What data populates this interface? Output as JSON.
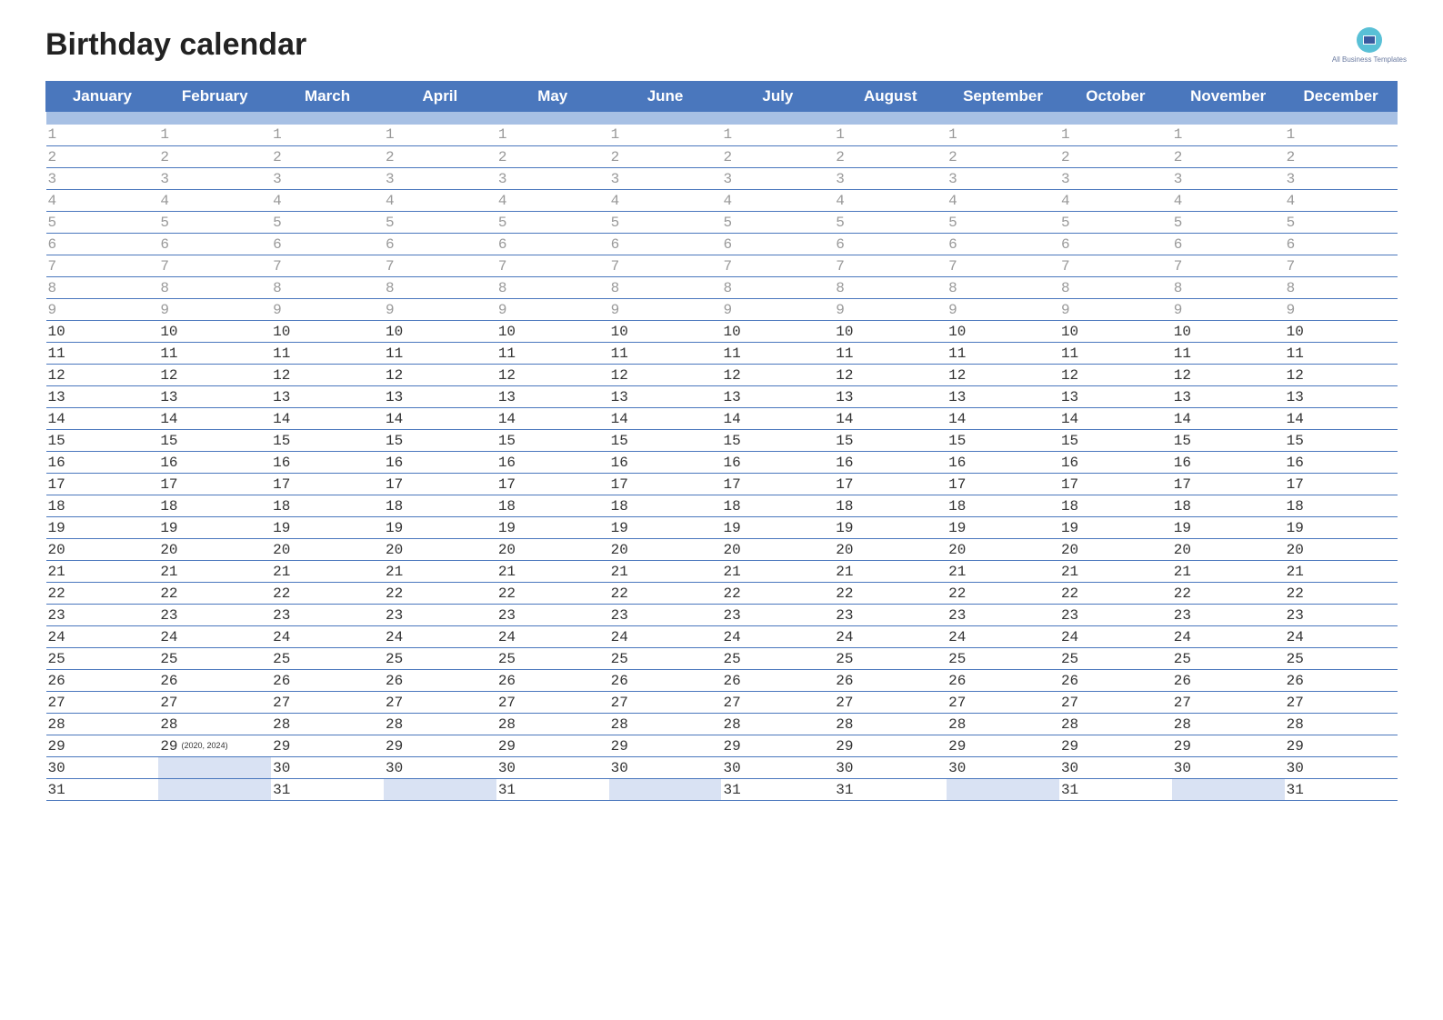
{
  "title": "Birthday calendar",
  "logo_text": "All Business\nTemplates",
  "months": [
    {
      "name": "January",
      "days": 31
    },
    {
      "name": "February",
      "days": 29,
      "notes": {
        "29": "(2020, 2024)"
      }
    },
    {
      "name": "March",
      "days": 31
    },
    {
      "name": "April",
      "days": 30
    },
    {
      "name": "May",
      "days": 31
    },
    {
      "name": "June",
      "days": 30
    },
    {
      "name": "July",
      "days": 31
    },
    {
      "name": "August",
      "days": 31
    },
    {
      "name": "September",
      "days": 30
    },
    {
      "name": "October",
      "days": 31
    },
    {
      "name": "November",
      "days": 30
    },
    {
      "name": "December",
      "days": 31
    }
  ],
  "max_rows": 31,
  "fade_threshold": 9
}
